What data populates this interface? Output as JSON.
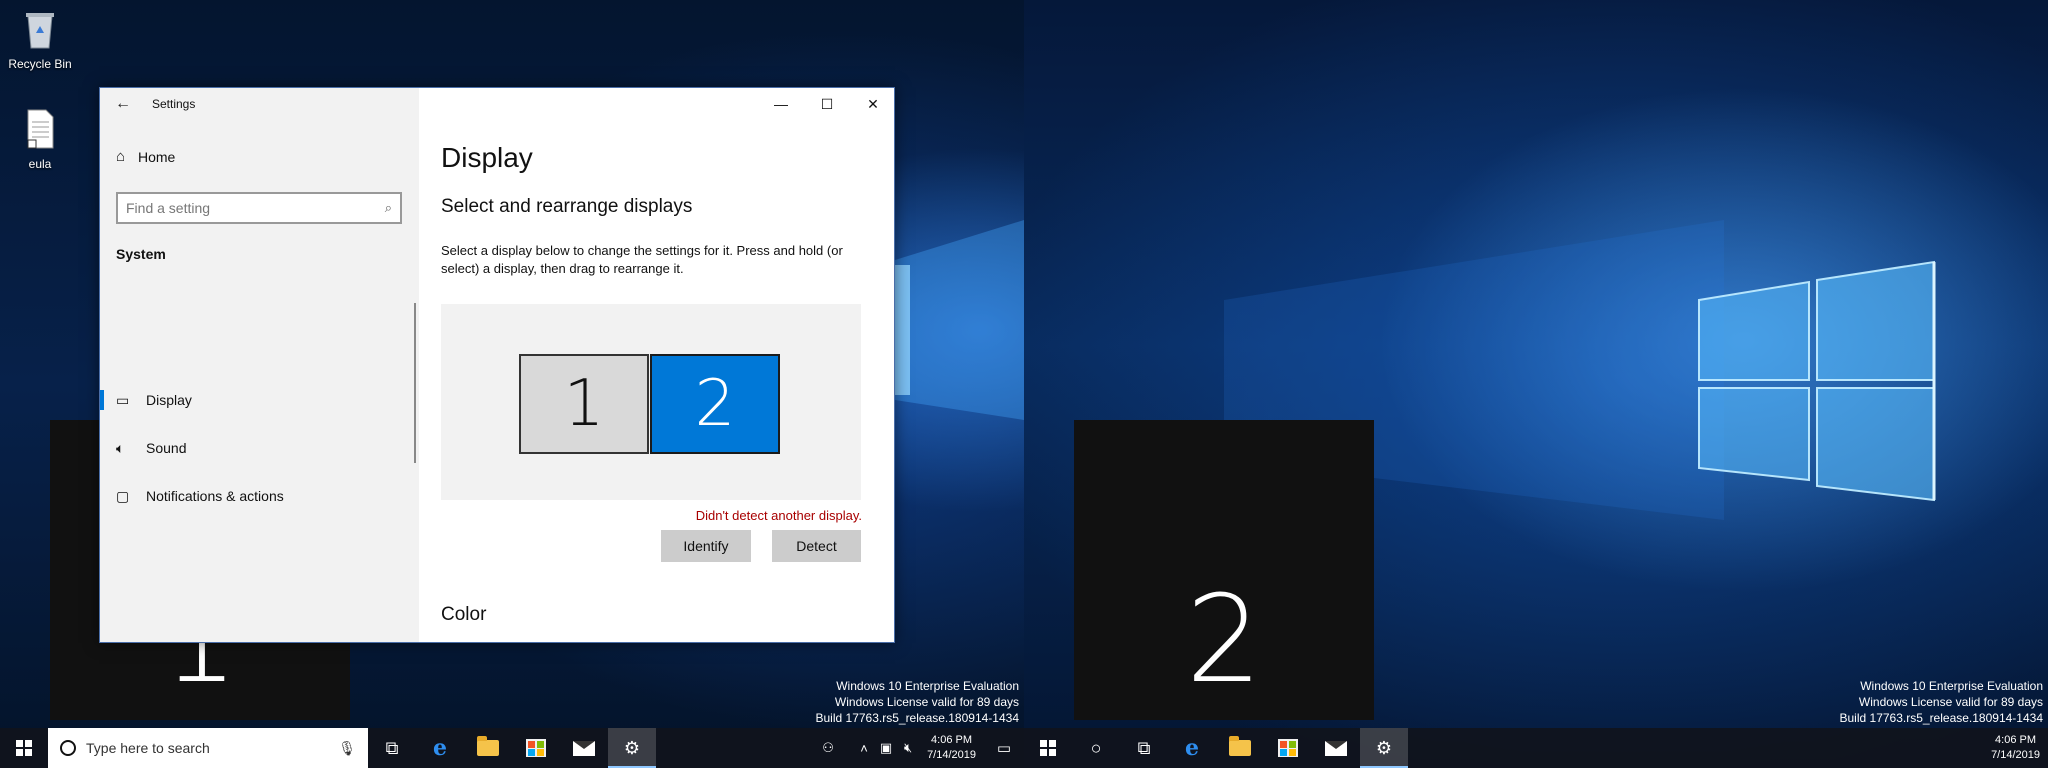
{
  "desktop": {
    "icons": [
      {
        "label": "Recycle Bin",
        "icon": "recycle-bin-icon"
      },
      {
        "label": "eula",
        "icon": "document-icon"
      }
    ],
    "watermark_left": [
      "Windows 10 Enterprise Evaluation",
      "Windows License valid for 89 days",
      "Build 17763.rs5_release.180914-1434"
    ],
    "watermark_right": [
      "Windows 10 Enterprise Evaluation",
      "Windows License valid for 89 days",
      "Build 17763.rs5_release.180914-1434"
    ],
    "identify_overlays": [
      "1",
      "2"
    ]
  },
  "settings": {
    "window_title": "Settings",
    "home_label": "Home",
    "search_placeholder": "Find a setting",
    "section_heading": "System",
    "nav_items": [
      {
        "label": "Display",
        "icon": "monitor-icon",
        "active": true
      },
      {
        "label": "Sound",
        "icon": "speaker-icon",
        "active": false
      },
      {
        "label": "Notifications & actions",
        "icon": "notification-icon",
        "active": false
      }
    ],
    "page_title": "Display",
    "subtitle": "Select and rearrange displays",
    "description": "Select a display below to change the settings for it. Press and hold (or select) a display, then drag to rearrange it.",
    "monitors": [
      "1",
      "2"
    ],
    "error_text": "Didn't detect another display.",
    "identify_label": "Identify",
    "detect_label": "Detect",
    "next_section": "Color"
  },
  "taskbar_left": {
    "search_placeholder": "Type here to search",
    "time": "4:06 PM",
    "date": "7/14/2019"
  },
  "taskbar_right": {
    "time": "4:06 PM",
    "date": "7/14/2019"
  },
  "colors": {
    "accent": "#0078d7",
    "error": "#a80000"
  }
}
